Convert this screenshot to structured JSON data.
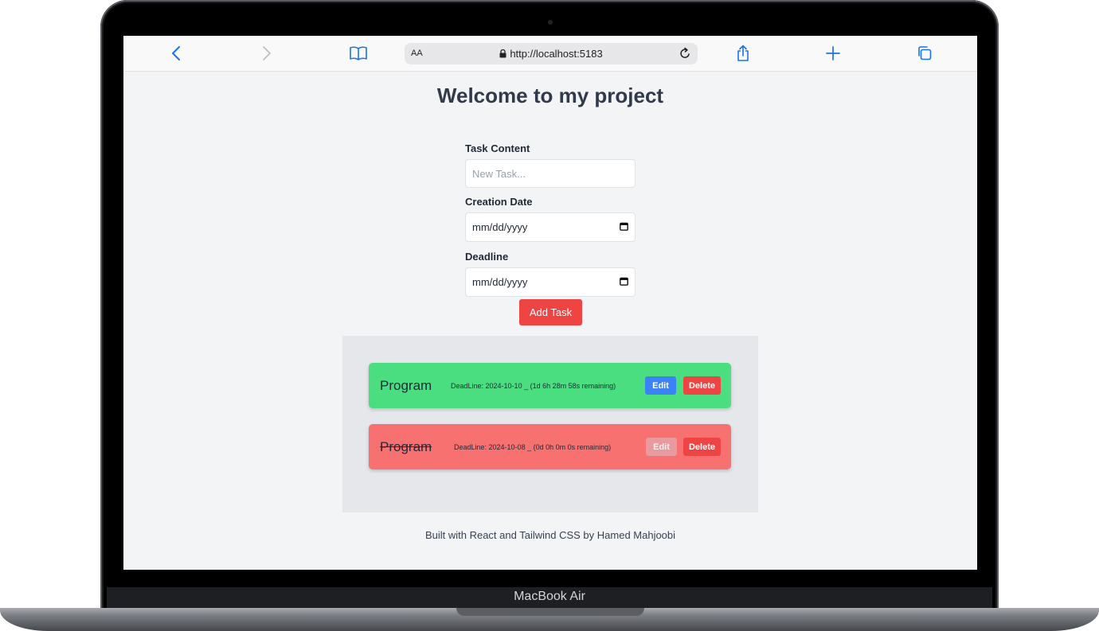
{
  "device": {
    "brand_label": "MacBook Air"
  },
  "browser": {
    "text_size_label": "AA",
    "url": "http://localhost:5183",
    "icons": [
      "back-icon",
      "forward-icon",
      "bookmarks-icon",
      "lock-icon",
      "reload-icon",
      "share-icon",
      "new-tab-icon",
      "tabs-icon"
    ]
  },
  "page": {
    "title": "Welcome to my project",
    "form": {
      "task_content_label": "Task Content",
      "task_content_placeholder": "New Task...",
      "creation_date_label": "Creation Date",
      "creation_date_value": "mm/dd/yyyy",
      "deadline_label": "Deadline",
      "deadline_value": "mm/dd/yyyy",
      "add_button_label": "Add Task"
    },
    "tasks": [
      {
        "name": "Program",
        "deadline": "DeadLine: 2024-10-10 _ (1d 6h 28m 58s remaining)",
        "edit_label": "Edit",
        "delete_label": "Delete",
        "color": "#4ade80",
        "completed": false
      },
      {
        "name": "Program",
        "deadline": "DeadLine: 2024-10-08 _ (0d 0h 0m 0s remaining)",
        "edit_label": "Edit",
        "delete_label": "Delete",
        "color": "#f87171",
        "completed": true
      }
    ],
    "footer": "Built with React and Tailwind CSS by Hamed Mahjoobi"
  },
  "colors": {
    "accent": "#ef4444",
    "edit": "#3b82f6",
    "screen_bg": "#f3f4f6"
  }
}
